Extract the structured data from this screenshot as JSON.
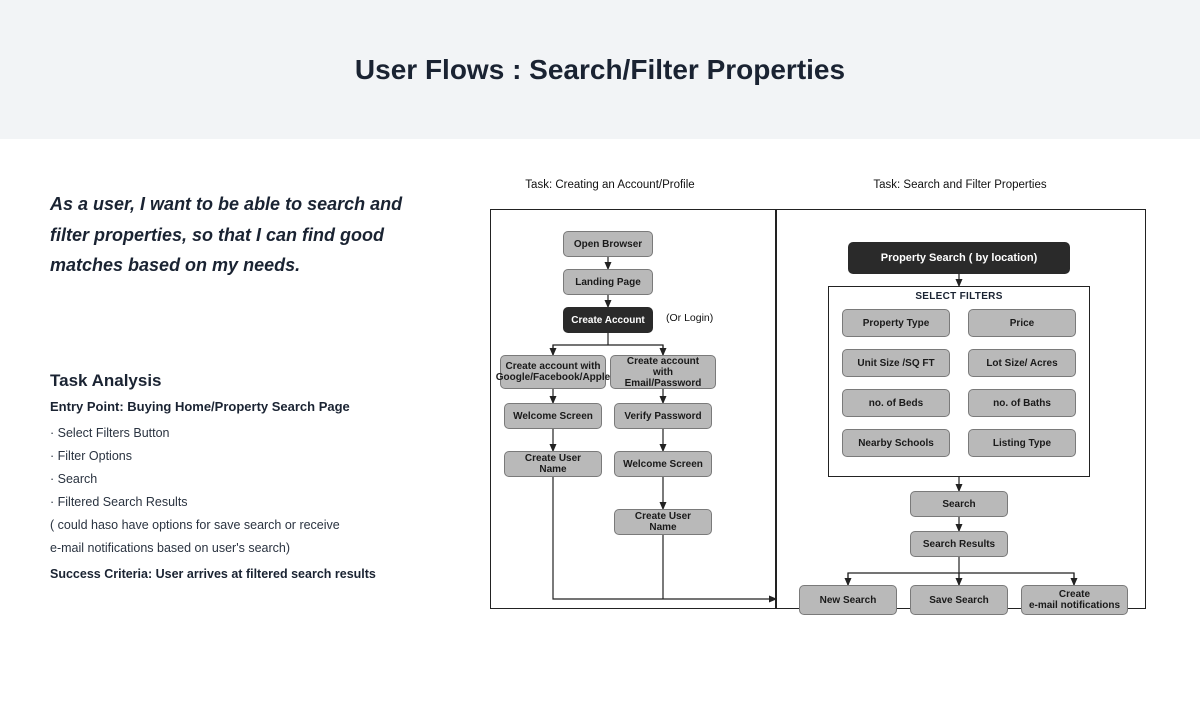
{
  "header": {
    "title": "User Flows : Search/Filter Properties"
  },
  "story": "As a user, I want to be able to search and filter properties, so that I can find good matches based on my needs.",
  "task_analysis": {
    "heading": "Task Analysis",
    "entry_point": "Entry Point: Buying Home/Property Search Page",
    "bullets": [
      "Select Filters Button",
      "Filter Options",
      "Search",
      "Filtered Search Results"
    ],
    "note1": "( could haso have options for save search or receive",
    "note2": "e-mail notifications based on user's search)",
    "success": "Success Criteria: User arrives at filtered search results"
  },
  "flow1": {
    "title": "Task: Creating an Account/Profile",
    "open_browser": "Open Browser",
    "landing_page": "Landing Page",
    "create_account": "Create Account",
    "or_login": "(Or Login)",
    "social": "Create account with Google/Facebook/Apple",
    "email": "Create account with Email/Password",
    "welcome1": "Welcome Screen",
    "verify": "Verify Password",
    "user1": "Create User Name",
    "welcome2": "Welcome Screen",
    "user2": "Create User Name"
  },
  "flow2": {
    "title": "Task: Search and Filter Properties",
    "property_search": "Property Search ( by location)",
    "filters_label": "SELECT FILTERS",
    "filters": {
      "prop_type": "Property Type",
      "price": "Price",
      "unit": "Unit Size /SQ FT",
      "lot": "Lot Size/ Acres",
      "beds": "no. of Beds",
      "baths": "no. of Baths",
      "schools": "Nearby Schools",
      "listing": "Listing Type"
    },
    "search": "Search",
    "results": "Search Results",
    "new_search": "New Search",
    "save_search": "Save Search",
    "notify": "Create\ne-mail notifications"
  }
}
